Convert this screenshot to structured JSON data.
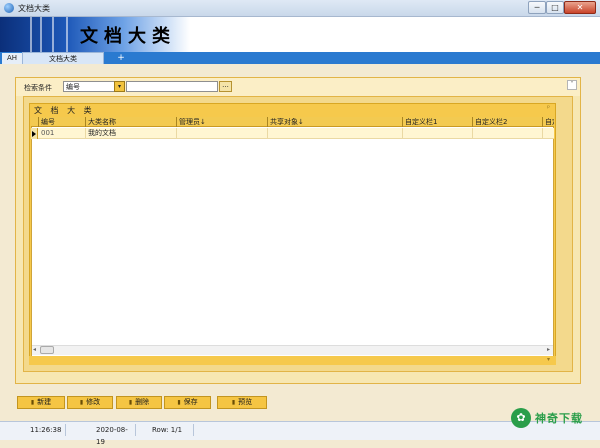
{
  "window": {
    "title": "文档大类",
    "minimize": "─",
    "maximize": "□",
    "close": "✕"
  },
  "banner": {
    "title": "文档大类"
  },
  "tabs": [
    {
      "label": "AH"
    },
    {
      "label": "文档大类"
    },
    {
      "label": "+"
    }
  ],
  "search": {
    "label": "检索条件",
    "field_value": "编号",
    "dropdown_icon": "▾",
    "input_value": "",
    "go_label": "...",
    "collapse_icon": "˅"
  },
  "grid": {
    "title": "文 档 大 类",
    "pin_icon": "ᵖ",
    "columns": [
      "编号",
      "大类名称",
      "管理员↓",
      "共享对象↓",
      "自定义栏1",
      "自定义栏2",
      "自定"
    ],
    "rows": [
      {
        "code": "001",
        "name": "我的文档",
        "admin": "",
        "share": "",
        "c1": "",
        "c2": "",
        "c3": ""
      }
    ],
    "scroll_left": "◂",
    "scroll_right": "▸",
    "footer_arrow": "▾"
  },
  "toolbar": {
    "new": "新建",
    "edit": "修改",
    "delete": "删除",
    "save": "保存",
    "preview": "预览"
  },
  "status": {
    "time": "11:26:38",
    "date": "2020-08-19",
    "row": "Row: 1/1"
  },
  "watermark": {
    "badge": "✿",
    "text": "神奇下载"
  },
  "colors": {
    "accent_blue": "#2a7ad0",
    "grid_header": "#f3ca51",
    "panel_orange": "#f6c94c"
  }
}
